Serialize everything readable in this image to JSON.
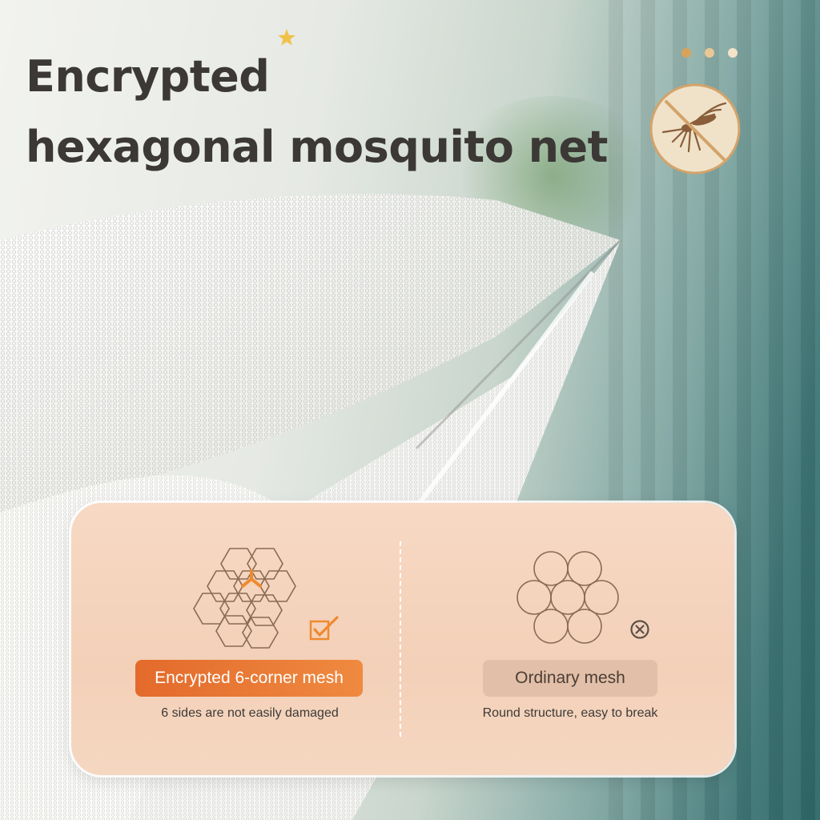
{
  "headline": {
    "line1": "Encrypted",
    "line2": "hexagonal mosquito net"
  },
  "decor": {
    "dot_colors": [
      "#d9a25a",
      "#e9c895",
      "#f3e3c8"
    ],
    "star_color": "#f0c24a",
    "badge_color": "#efe2c9",
    "badge_ring": "#d4a36a",
    "icons": [
      "star-icon",
      "mosquito-icon",
      "no-entry-slash-icon"
    ]
  },
  "comparison": {
    "left": {
      "label": "Encrypted 6-corner mesh",
      "caption": "6 sides are not easily damaged",
      "icon": "hexagon-mesh-icon",
      "status_icon": "checkbox-checked-icon"
    },
    "right": {
      "label": "Ordinary mesh",
      "caption": "Round structure, easy to break",
      "icon": "circle-mesh-icon",
      "status_icon": "circled-x-icon"
    }
  },
  "colors": {
    "accent": "#e87733",
    "text_dark": "#3b3835",
    "panel": "#f4d3bc",
    "line_brown": "#8a6a52"
  }
}
